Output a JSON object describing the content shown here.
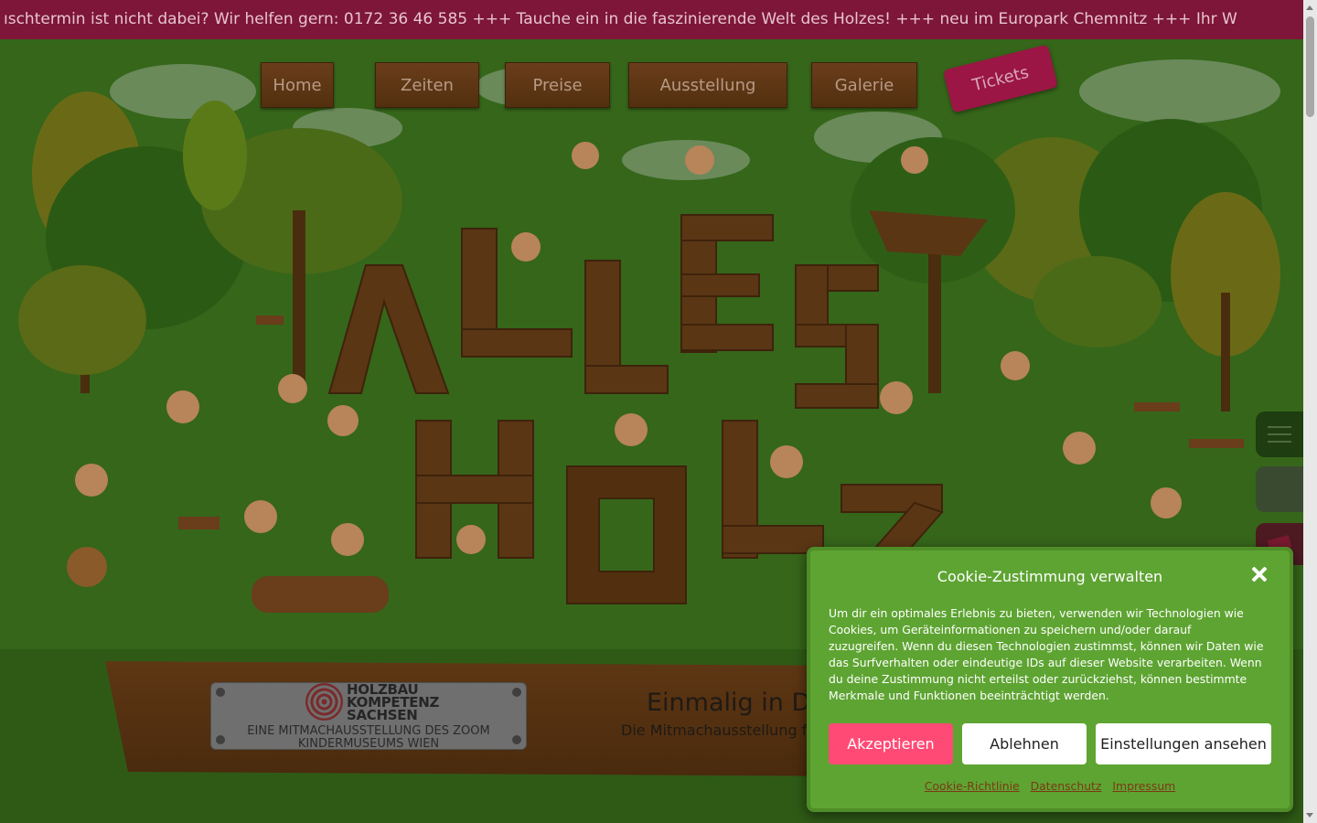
{
  "ticker": {
    "text": "ıschtermin ist nicht dabei? Wir helfen gern: 0172 36 46 585 +++ Tauche ein in die faszinierende Welt des Holzes! +++ neu im Europark Chemnitz +++ Ihr W"
  },
  "nav": {
    "items": [
      {
        "label": "Home"
      },
      {
        "label": "Zeiten"
      },
      {
        "label": "Preise"
      },
      {
        "label": "Ausstellung"
      },
      {
        "label": "Galerie"
      }
    ],
    "tickets_label": "Tickets"
  },
  "side": {
    "menu_icon": "hamburger-icon",
    "instagram_icon": "instagram-icon",
    "ticket_icon": "ticket-icon"
  },
  "banner": {
    "logo_line1": "HOLZBAU",
    "logo_line2": "KOMPETENZ",
    "logo_line3": "SACHSEN",
    "plaque_text": "EINE MITMACHAUSSTELLUNG DES ZOOM KINDERMUSEUMS WIEN",
    "headline": "Einmalig in D",
    "subline": "Die Mitmachausstellung f"
  },
  "cookie": {
    "title": "Cookie-Zustimmung verwalten",
    "body": "Um dir ein optimales Erlebnis zu bieten, verwenden wir Technologien wie Cookies, um Geräteinformationen zu speichern und/oder darauf zuzugreifen. Wenn du diesen Technologien zustimmst, können wir Daten wie das Surfverhalten oder eindeutige IDs auf dieser Website verarbeiten. Wenn du deine Zustimmung nicht erteilst oder zurückziehst, können bestimmte Merkmale und Funktionen beeinträchtigt werden.",
    "accept_label": "Akzeptieren",
    "deny_label": "Ablehnen",
    "settings_label": "Einstellungen ansehen",
    "links": [
      "Cookie-Richtlinie",
      "Datenschutz",
      "Impressum"
    ]
  },
  "colors": {
    "ticker_bg": "#7d1638",
    "scene_green": "#3a6a1b",
    "cookie_bg": "#5ea432",
    "accept_bg": "#ff4a75",
    "tickets_bg": "#9b1644"
  }
}
